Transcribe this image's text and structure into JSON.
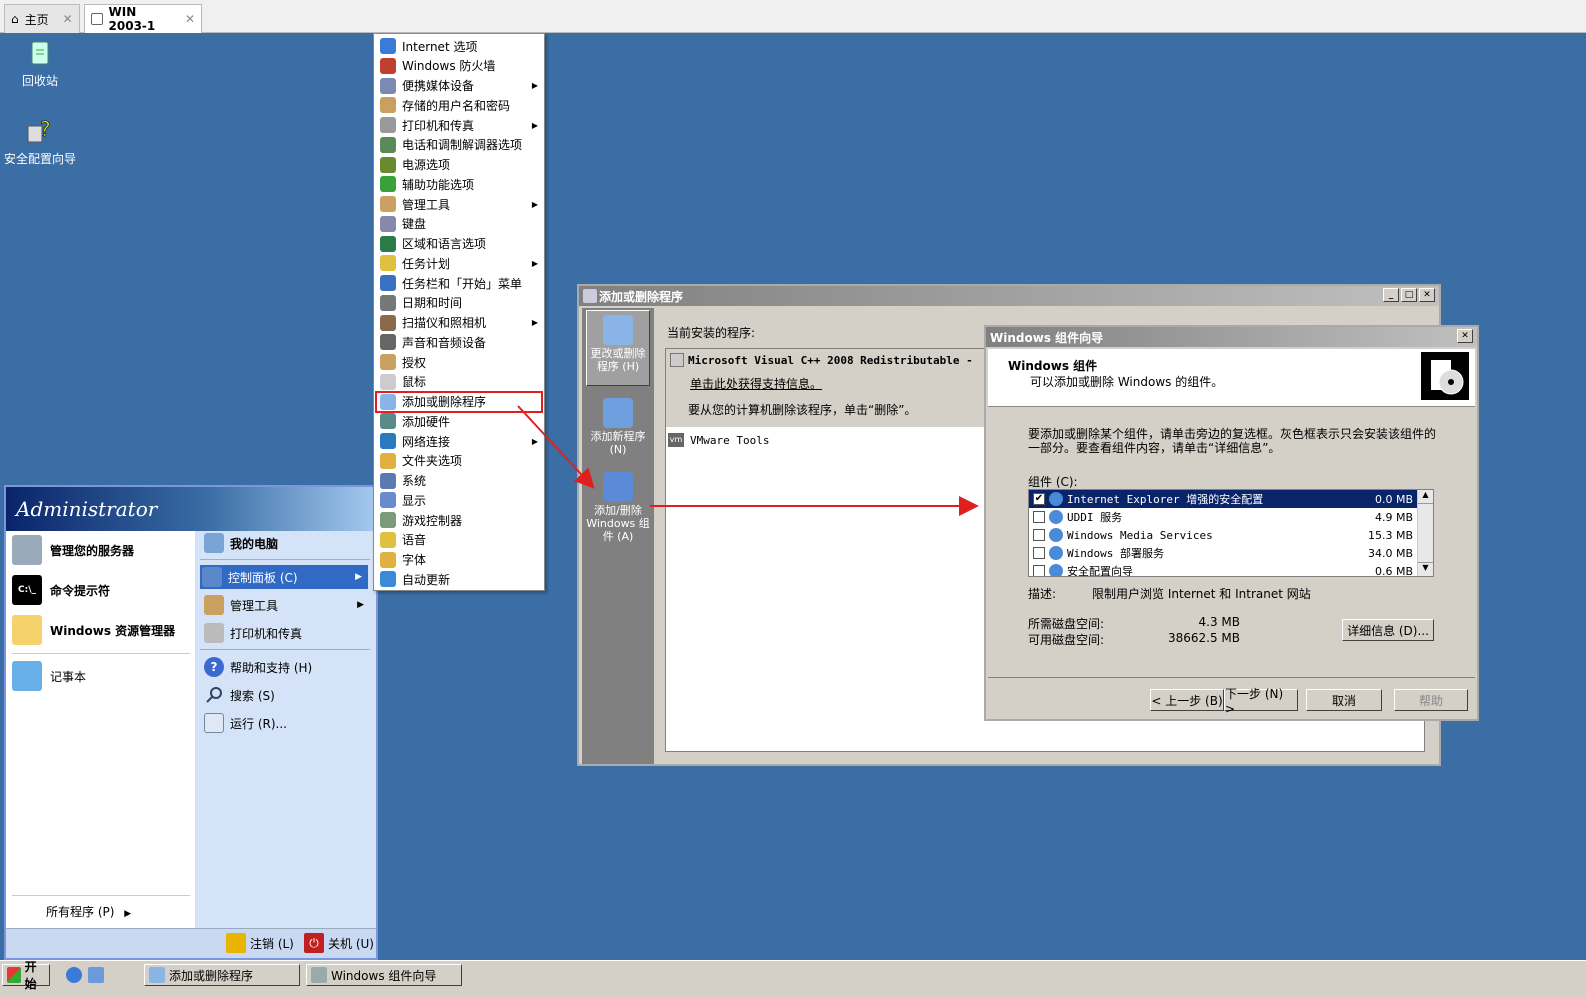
{
  "tabs": [
    {
      "label": "主页",
      "icon": "home-icon"
    },
    {
      "label": "WIN 2003-1",
      "icon": "vm-icon"
    }
  ],
  "desktop": {
    "icons": [
      {
        "label": "回收站",
        "icon": "recycle-bin-icon"
      },
      {
        "label": "安全配置向导",
        "icon": "security-wizard-icon"
      }
    ]
  },
  "start_menu": {
    "user": "Administrator",
    "left_items": [
      {
        "label": "管理您的服务器"
      },
      {
        "label": "命令提示符"
      },
      {
        "label": "Windows 资源管理器"
      },
      {
        "label": "记事本"
      }
    ],
    "all_programs": "所有程序 (P)",
    "right_items": [
      {
        "label": "我的电脑"
      },
      {
        "label": "控制面板 (C)"
      },
      {
        "label": "管理工具"
      },
      {
        "label": "打印机和传真"
      },
      {
        "label": "帮助和支持 (H)"
      },
      {
        "label": "搜索 (S)"
      },
      {
        "label": "运行 (R)..."
      }
    ],
    "logoff": "注销 (L)",
    "shutdown": "关机 (U)"
  },
  "control_panel": {
    "items": [
      {
        "label": "Internet 选项"
      },
      {
        "label": "Windows 防火墙"
      },
      {
        "label": "便携媒体设备"
      },
      {
        "label": "存储的用户名和密码"
      },
      {
        "label": "打印机和传真"
      },
      {
        "label": "电话和调制解调器选项"
      },
      {
        "label": "电源选项"
      },
      {
        "label": "辅助功能选项"
      },
      {
        "label": "管理工具"
      },
      {
        "label": "键盘"
      },
      {
        "label": "区域和语言选项"
      },
      {
        "label": "任务计划"
      },
      {
        "label": "任务栏和「开始」菜单"
      },
      {
        "label": "日期和时间"
      },
      {
        "label": "扫描仪和照相机"
      },
      {
        "label": "声音和音频设备"
      },
      {
        "label": "授权"
      },
      {
        "label": "鼠标"
      },
      {
        "label": "添加或删除程序"
      },
      {
        "label": "添加硬件"
      },
      {
        "label": "网络连接"
      },
      {
        "label": "文件夹选项"
      },
      {
        "label": "系统"
      },
      {
        "label": "显示"
      },
      {
        "label": "游戏控制器"
      },
      {
        "label": "语音"
      },
      {
        "label": "字体"
      },
      {
        "label": "自动更新"
      }
    ]
  },
  "arp_window": {
    "title": "添加或删除程序",
    "side_buttons": [
      {
        "label": "更改或删除程序 (H)"
      },
      {
        "label": "添加新程序 (N)"
      },
      {
        "label": "添加/删除 Windows 组件 (A)"
      }
    ],
    "current_label": "当前安装的程序:",
    "program_name": "Microsoft Visual C++ 2008 Redistributable -",
    "support_link": "单击此处获得支持信息。",
    "remove_hint": "要从您的计算机删除该程序，单击“删除”。",
    "program2": "VMware Tools"
  },
  "wizard": {
    "title": "Windows 组件向导",
    "header_title": "Windows 组件",
    "header_sub": "可以添加或删除 Windows 的组件。",
    "instructions_1": "要添加或删除某个组件，请单击旁边的复选框。灰色框表示只会安装该组件的",
    "instructions_2": "一部分。要查看组件内容，请单击“详细信息”。",
    "components_label": "组件 (C):",
    "components": [
      {
        "name": "Internet Explorer 增强的安全配置",
        "size": "0.0 MB",
        "checked": "✔"
      },
      {
        "name": "UDDI 服务",
        "size": "4.9 MB",
        "checked": ""
      },
      {
        "name": "Windows Media Services",
        "size": "15.3 MB",
        "checked": ""
      },
      {
        "name": "Windows 部署服务",
        "size": "34.0 MB",
        "checked": ""
      },
      {
        "name": "安全配置向导",
        "size": "0.6 MB",
        "checked": ""
      }
    ],
    "desc_label": "描述:",
    "desc_text": "限制用户浏览 Internet 和 Intranet 网站",
    "required_label": "所需磁盘空间:",
    "required_value": "4.3 MB",
    "available_label": "可用磁盘空间:",
    "available_value": "38662.5 MB",
    "details_btn": "详细信息 (D)...",
    "back_btn": "< 上一步 (B)",
    "next_btn": "下一步 (N) >",
    "cancel_btn": "取消",
    "help_btn": "帮助"
  },
  "taskbar": {
    "start": "开始",
    "tasks": [
      {
        "label": "添加或删除程序"
      },
      {
        "label": "Windows 组件向导"
      }
    ]
  },
  "colors": {
    "desktop": "#3a6ea5",
    "highlight": "#316ac5",
    "annotation_red": "#e02020"
  }
}
